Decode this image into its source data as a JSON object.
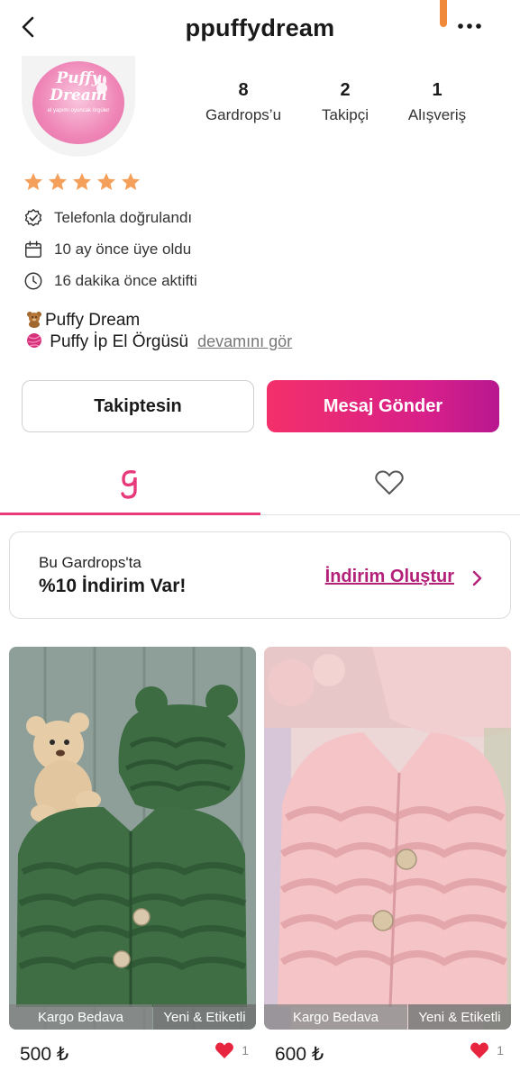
{
  "header": {
    "title": "ppuffydream",
    "back_icon": "chevron-left-icon",
    "more_icon": "more-horizontal-icon"
  },
  "avatar": {
    "logo_text_line1": "Puffy",
    "logo_text_line2": "Dream",
    "logo_subtext": "el yapımı oyuncak örgüler",
    "logo_colors": [
      "#f9c7de",
      "#ef86b7"
    ]
  },
  "stats": [
    {
      "value": "8",
      "label": "Gardrops’u"
    },
    {
      "value": "2",
      "label": "Takipçi"
    },
    {
      "value": "1",
      "label": "Alışveriş"
    }
  ],
  "rating": {
    "stars": 5,
    "max": 5,
    "color": "#f5a05a"
  },
  "info": [
    {
      "icon": "verified-check-icon",
      "text": "Telefonla doğrulandı"
    },
    {
      "icon": "calendar-icon",
      "text": "10 ay önce üye oldu"
    },
    {
      "icon": "clock-icon",
      "text": "16 dakika önce aktifti"
    }
  ],
  "bio": {
    "line1": "Puffy Dream",
    "line1_emoji": "teddy-bear-icon",
    "line2": "Puffy İp El Örgüsü",
    "line2_emoji": "yarn-ball-icon",
    "more_link": "devamını gör"
  },
  "actions": {
    "follow_label": "Takiptesin",
    "message_label": "Mesaj Gönder",
    "accent": "#f4306a"
  },
  "tabs": [
    {
      "icon": "gardrops-logo-icon",
      "active": true
    },
    {
      "icon": "heart-outline-icon",
      "active": false
    }
  ],
  "promo": {
    "line1": "Bu Gardrops'ta",
    "line2": "%10 İndirim Var!",
    "link": "İndirim Oluştur",
    "link_color": "#b3207a"
  },
  "products": [
    {
      "image": "green-knit-vest-with-teddy-bear",
      "badge_left": "Kargo Bedava",
      "badge_right": "Yeni & Etiketli",
      "price": "500 ₺",
      "likes": "1"
    },
    {
      "image": "pink-knit-vest",
      "badge_left": "Kargo Bedava",
      "badge_right": "Yeni & Etiketli",
      "price": "600 ₺",
      "likes": "1"
    }
  ]
}
